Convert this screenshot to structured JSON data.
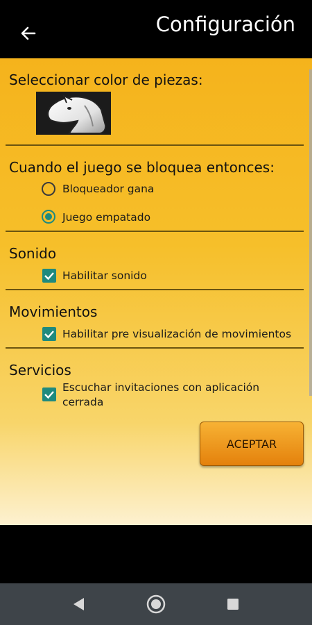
{
  "app_bar": {
    "title": "Configuración",
    "back_icon": "arrow-left-icon"
  },
  "sections": {
    "piece_color": {
      "title": "Seleccionar color de piezas:",
      "piece_icon": "white-knight-icon"
    },
    "blocked": {
      "title": "Cuando el juego se bloquea entonces:",
      "options": [
        {
          "label": "Bloqueador gana",
          "selected": false
        },
        {
          "label": "Juego empatado",
          "selected": true
        }
      ]
    },
    "sound": {
      "title": "Sonido",
      "checkbox": {
        "label": "Habilitar sonido",
        "checked": true
      }
    },
    "moves": {
      "title": "Movimientos",
      "checkbox": {
        "label": "Habilitar pre visualización de movimientos",
        "checked": true
      }
    },
    "services": {
      "title": "Servicios",
      "checkbox": {
        "label_line1": "Escuchar invitaciones con aplicación",
        "label_line2": "cerrada",
        "checked": true
      }
    }
  },
  "accept_button": {
    "label": "ACEPTAR"
  },
  "colors": {
    "accent": "#1f8a7e",
    "background_top": "#f5b31c",
    "button": "#e4810c"
  },
  "nav_bar": {
    "icons": [
      "back-triangle-icon",
      "home-circle-icon",
      "recents-square-icon"
    ]
  }
}
